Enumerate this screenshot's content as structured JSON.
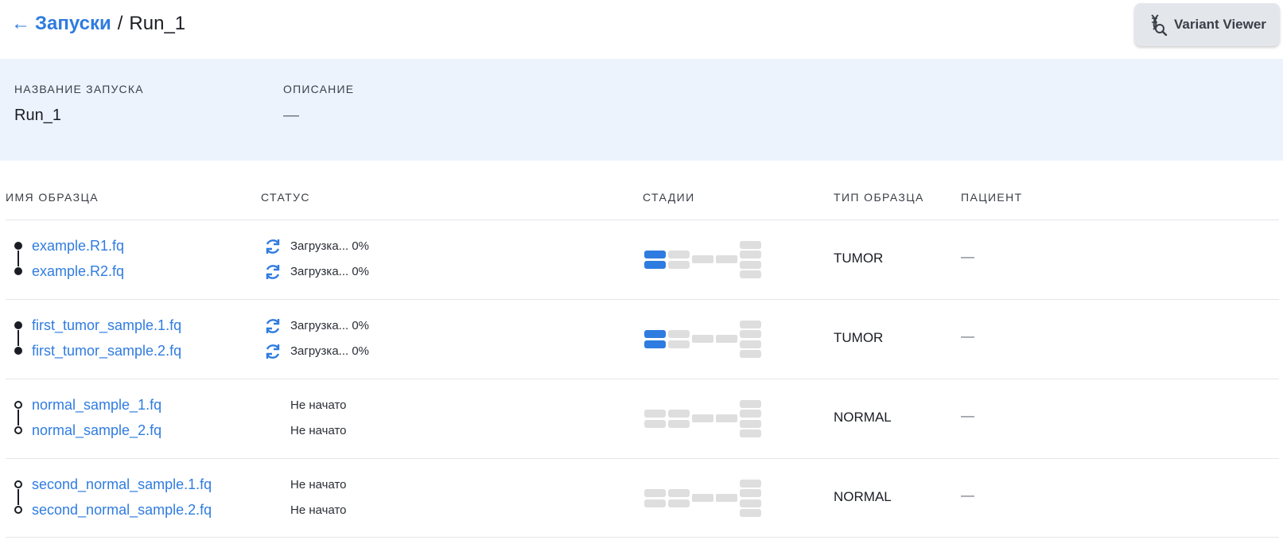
{
  "breadcrumb": {
    "back": "←",
    "parent": "Запуски",
    "separator": "/",
    "current": "Run_1"
  },
  "variant_viewer_button": {
    "label": "Variant Viewer",
    "icon": "dna-search-icon"
  },
  "info": {
    "name_label": "НАЗВАНИЕ ЗАПУСКА",
    "name_value": "Run_1",
    "description_label": "ОПИСАНИЕ",
    "description_value": "—"
  },
  "table": {
    "headers": {
      "sample_name": "ИМЯ ОБРАЗЦА",
      "status": "СТАТУС",
      "stages": "СТАДИИ",
      "sample_type": "ТИП ОБРАЗЦА",
      "patient": "ПАЦИЕНТ"
    },
    "rows": [
      {
        "file1": "example.R1.fq",
        "file2": "example.R2.fq",
        "status1": "Загрузка... 0%",
        "status2": "Загрузка... 0%",
        "type": "TUMOR",
        "patient": "—"
      },
      {
        "file1": "first_tumor_sample.1.fq",
        "file2": "first_tumor_sample.2.fq",
        "status1": "Загрузка... 0%",
        "status2": "Загрузка... 0%",
        "type": "TUMOR",
        "patient": "—"
      },
      {
        "file1": "normal_sample_1.fq",
        "file2": "normal_sample_2.fq",
        "status1": "Не начато",
        "status2": "Не начато",
        "type": "NORMAL",
        "patient": "—"
      },
      {
        "file1": "second_normal_sample.1.fq",
        "file2": "second_normal_sample.2.fq",
        "status1": "Не начато",
        "status2": "Не начато",
        "type": "NORMAL",
        "patient": "—"
      }
    ]
  },
  "colors": {
    "accent": "#2f7ce0",
    "stage_active": "#2f7ce0",
    "stage_inactive": "#dedede",
    "panel_bg": "#edf3fd"
  }
}
